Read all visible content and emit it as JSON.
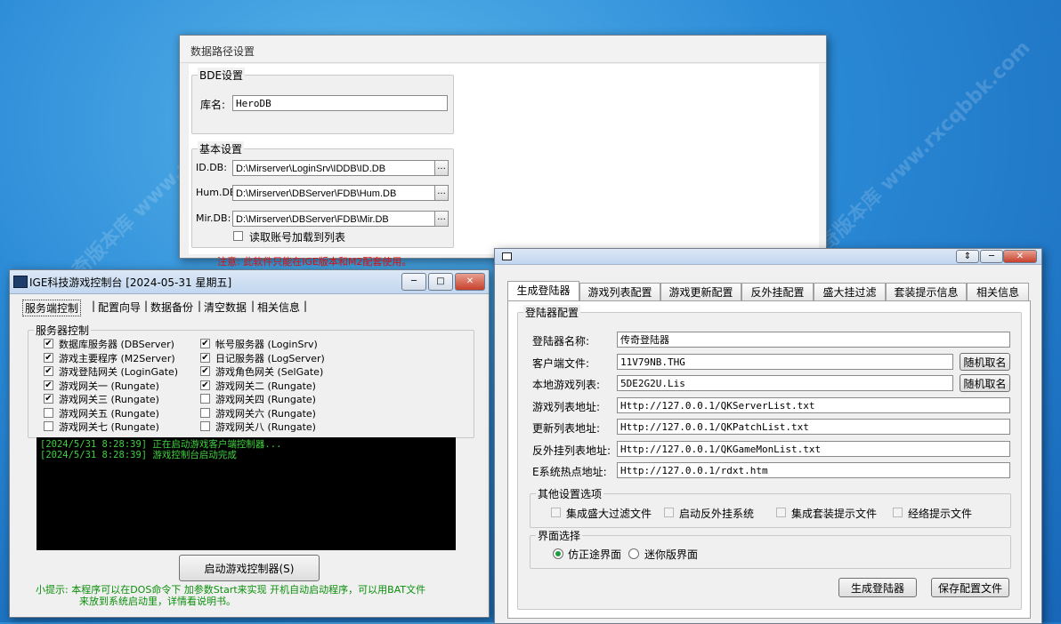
{
  "watermark": "协位传奇版本库 www.rxcqbbk.com",
  "db_window": {
    "title": "数据路径设置",
    "bde_group": "BDE设置",
    "db_name_label": "库名:",
    "db_name_value": "HeroDB",
    "basic_group": "基本设置",
    "id_label": "ID.DB:",
    "id_value": "D:\\Mirserver\\LoginSrv\\IDDB\\ID.DB",
    "hum_label": "Hum.DB",
    "hum_value": "D:\\Mirserver\\DBServer\\FDB\\Hum.DB",
    "mir_label": "Mir.DB:",
    "mir_value": "D:\\Mirserver\\DBServer\\FDB\\Mir.DB",
    "browse": "...",
    "load_accounts": "读取账号加载到列表",
    "notice": "注意: 此软件只能在IGE版本和M2配套使用。"
  },
  "console_window": {
    "title": "IGE科技游戏控制台 [2024-05-31 星期五]",
    "tabs": [
      "服务端控制",
      "配置向导",
      "数据备份",
      "清空数据",
      "相关信息"
    ],
    "group_title": "服务器控制",
    "servers_left": [
      {
        "label": "数据库服务器 (DBServer)",
        "checked": true
      },
      {
        "label": "游戏主要程序 (M2Server)",
        "checked": true
      },
      {
        "label": "游戏登陆网关 (LoginGate)",
        "checked": true
      },
      {
        "label": "游戏网关一 (Rungate)",
        "checked": true
      },
      {
        "label": "游戏网关三 (Rungate)",
        "checked": true
      },
      {
        "label": "游戏网关五 (Rungate)",
        "checked": false
      },
      {
        "label": "游戏网关七 (Rungate)",
        "checked": false
      }
    ],
    "servers_right": [
      {
        "label": "帐号服务器 (LoginSrv)",
        "checked": true
      },
      {
        "label": "日记服务器 (LogServer)",
        "checked": true
      },
      {
        "label": "游戏角色网关 (SelGate)",
        "checked": true
      },
      {
        "label": "游戏网关二 (Rungate)",
        "checked": true
      },
      {
        "label": "游戏网关四 (Rungate)",
        "checked": false
      },
      {
        "label": "游戏网关六 (Rungate)",
        "checked": false
      },
      {
        "label": "游戏网关八 (Rungate)",
        "checked": false
      }
    ],
    "log": [
      "[2024/5/31 8:28:39] 正在启动游戏客户端控制器...",
      "[2024/5/31 8:28:39] 游戏控制台启动完成"
    ],
    "start_button": "启动游戏控制器(S)",
    "tip_line1": "小提示: 本程序可以在DOS命令下 加参数Start来实现 开机自动启动程序，可以用BAT文件",
    "tip_line2": "来放到系统启动里，详情看说明书。"
  },
  "login_window": {
    "tabs": [
      "生成登陆器",
      "游戏列表配置",
      "游戏更新配置",
      "反外挂配置",
      "盛大挂过滤",
      "套装提示信息",
      "相关信息"
    ],
    "group_title": "登陆器配置",
    "fields": [
      {
        "label": "登陆器名称:",
        "value": "传奇登陆器"
      },
      {
        "label": "客户端文件:",
        "value": "11V79NB.THG",
        "button": "随机取名"
      },
      {
        "label": "本地游戏列表:",
        "value": "5DE2G2U.Lis",
        "button": "随机取名"
      },
      {
        "label": "游戏列表地址:",
        "value": "Http://127.0.0.1/QKServerList.txt"
      },
      {
        "label": "更新列表地址:",
        "value": "Http://127.0.0.1/QKPatchList.txt"
      },
      {
        "label": "反外挂列表地址:",
        "value": "Http://127.0.0.1/QKGameMonList.txt"
      },
      {
        "label": "E系统热点地址:",
        "value": "Http://127.0.0.1/rdxt.htm"
      }
    ],
    "other_group": "其他设置选项",
    "options": [
      "集成盛大过滤文件",
      "启动反外挂系统",
      "集成套装提示文件",
      "经络提示文件"
    ],
    "ui_group": "界面选择",
    "ui_options": [
      "仿正途界面",
      "迷你版界面"
    ],
    "generate_button": "生成登陆器",
    "save_button": "保存配置文件"
  }
}
